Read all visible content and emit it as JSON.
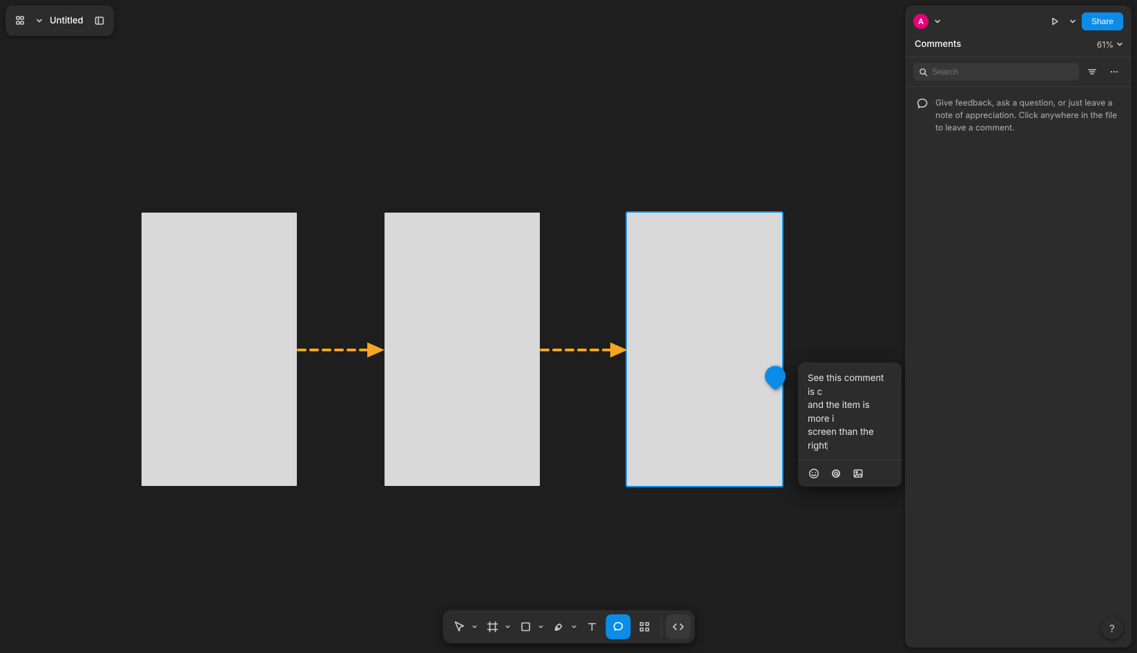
{
  "document": {
    "title": "Untitled"
  },
  "header": {
    "share_label": "Share",
    "avatar_initial": "A"
  },
  "sidebar": {
    "title": "Comments",
    "zoom_label": "61%",
    "search_placeholder": "Search",
    "hint": "Give feedback, ask a question, or just leave a note of appreciation. Click anywhere in the file to leave a comment."
  },
  "comment_draft": {
    "line1": "See this comment is c",
    "line2": "and the item is more i",
    "line3": "screen than the right"
  },
  "toolbar": {
    "tools": [
      "move",
      "frame",
      "shape",
      "pen",
      "text",
      "comment",
      "components",
      "devmode"
    ]
  },
  "help_label": "?"
}
